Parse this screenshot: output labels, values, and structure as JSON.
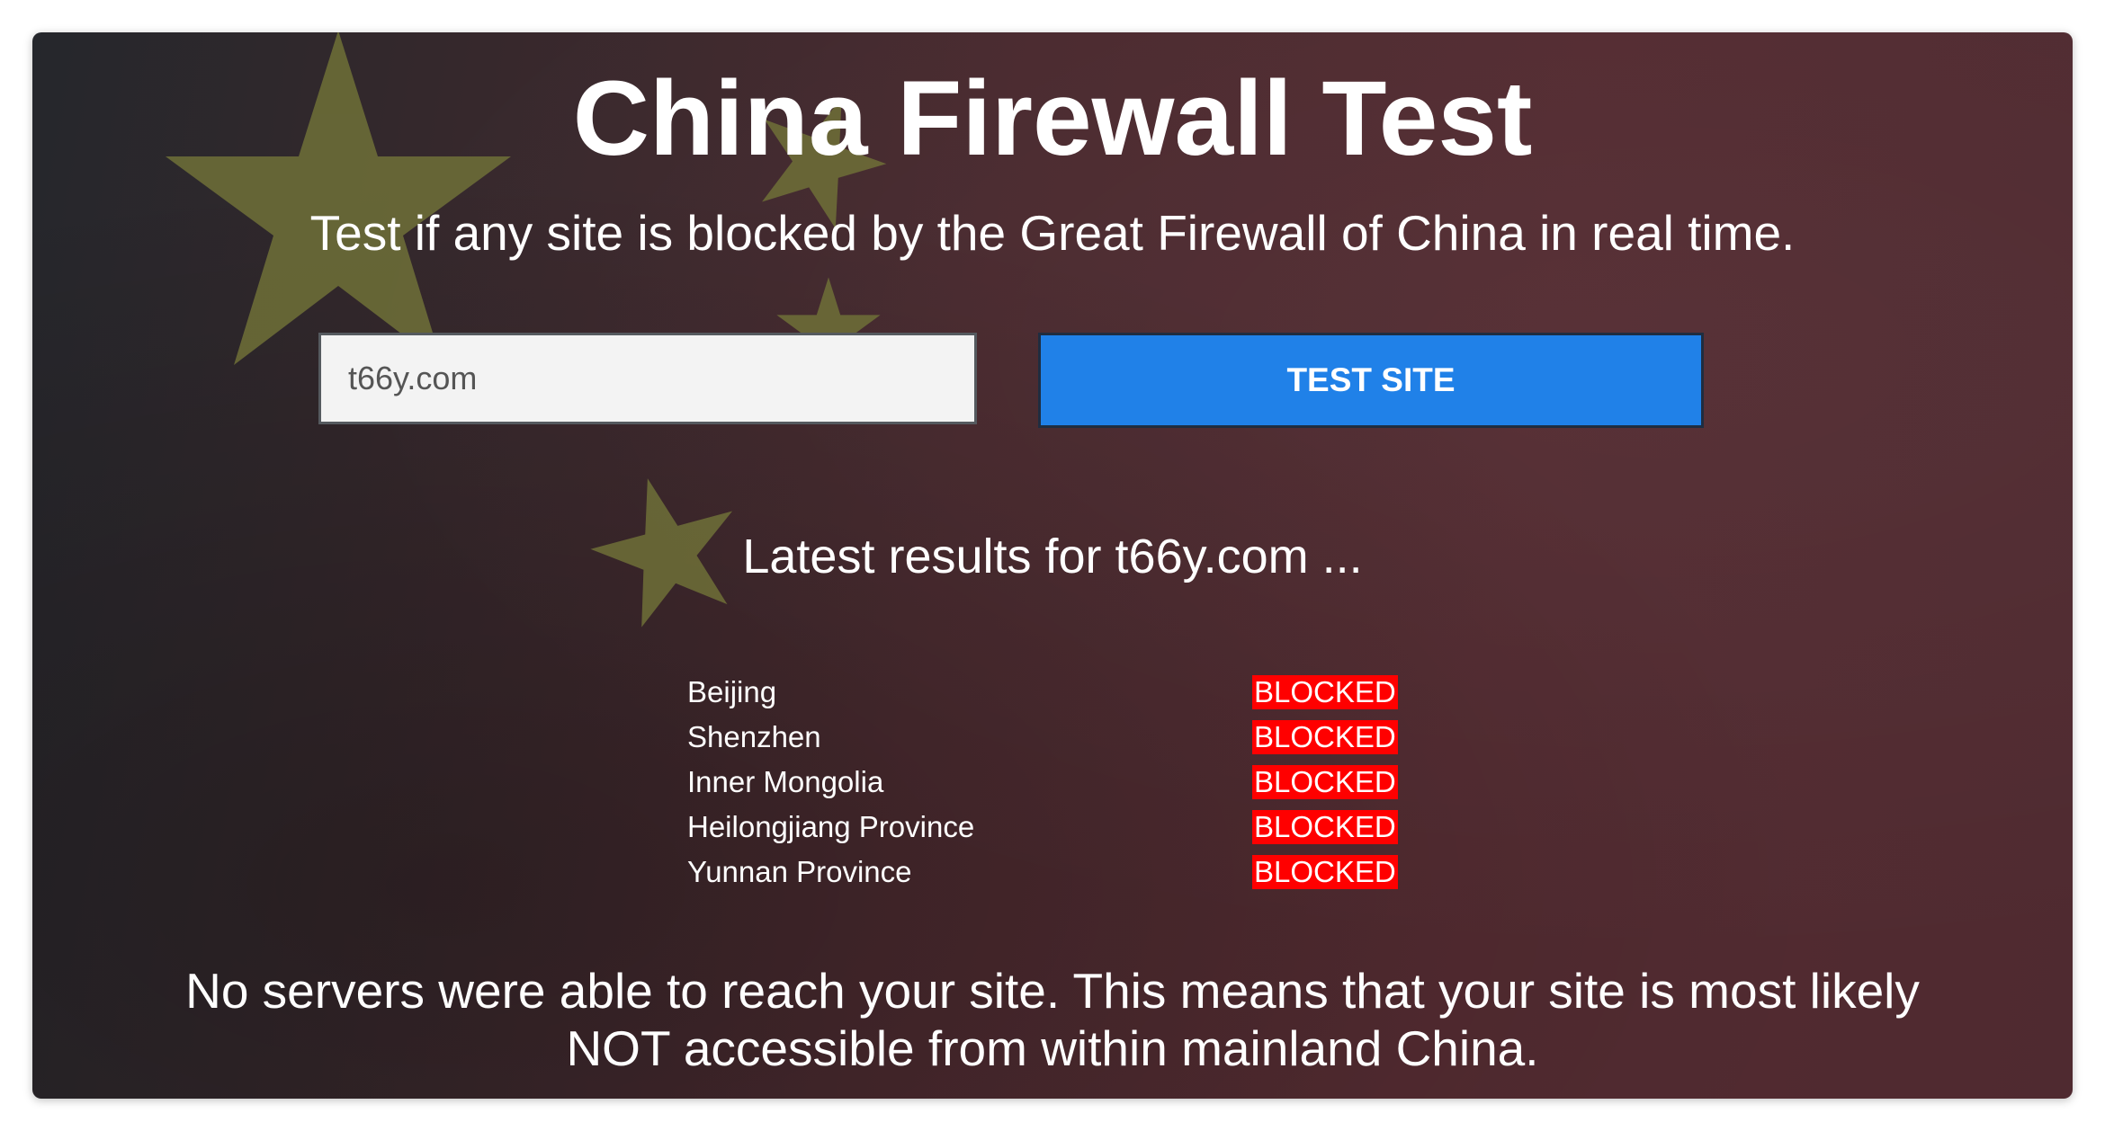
{
  "header": {
    "title": "China Firewall Test",
    "subtitle": "Test if any site is blocked by the Great Firewall of China in real time."
  },
  "search": {
    "value": "t66y.com",
    "button_label": "TEST SITE"
  },
  "results": {
    "heading": "Latest results for t66y.com ...",
    "rows": [
      {
        "location": "Beijing",
        "status": "BLOCKED"
      },
      {
        "location": "Shenzhen",
        "status": "BLOCKED"
      },
      {
        "location": "Inner Mongolia",
        "status": "BLOCKED"
      },
      {
        "location": "Heilongjiang Province",
        "status": "BLOCKED"
      },
      {
        "location": "Yunnan Province",
        "status": "BLOCKED"
      }
    ],
    "conclusion_line1": "No servers were able to reach your site. This means that your site is most likely",
    "conclusion_line2": "NOT accessible from within mainland China."
  },
  "colors": {
    "button": "#2081e8",
    "blocked": "#ff0000",
    "star": "#6f7038"
  },
  "background": {
    "icons": [
      "star-icon",
      "star-icon",
      "star-icon",
      "star-icon"
    ]
  }
}
